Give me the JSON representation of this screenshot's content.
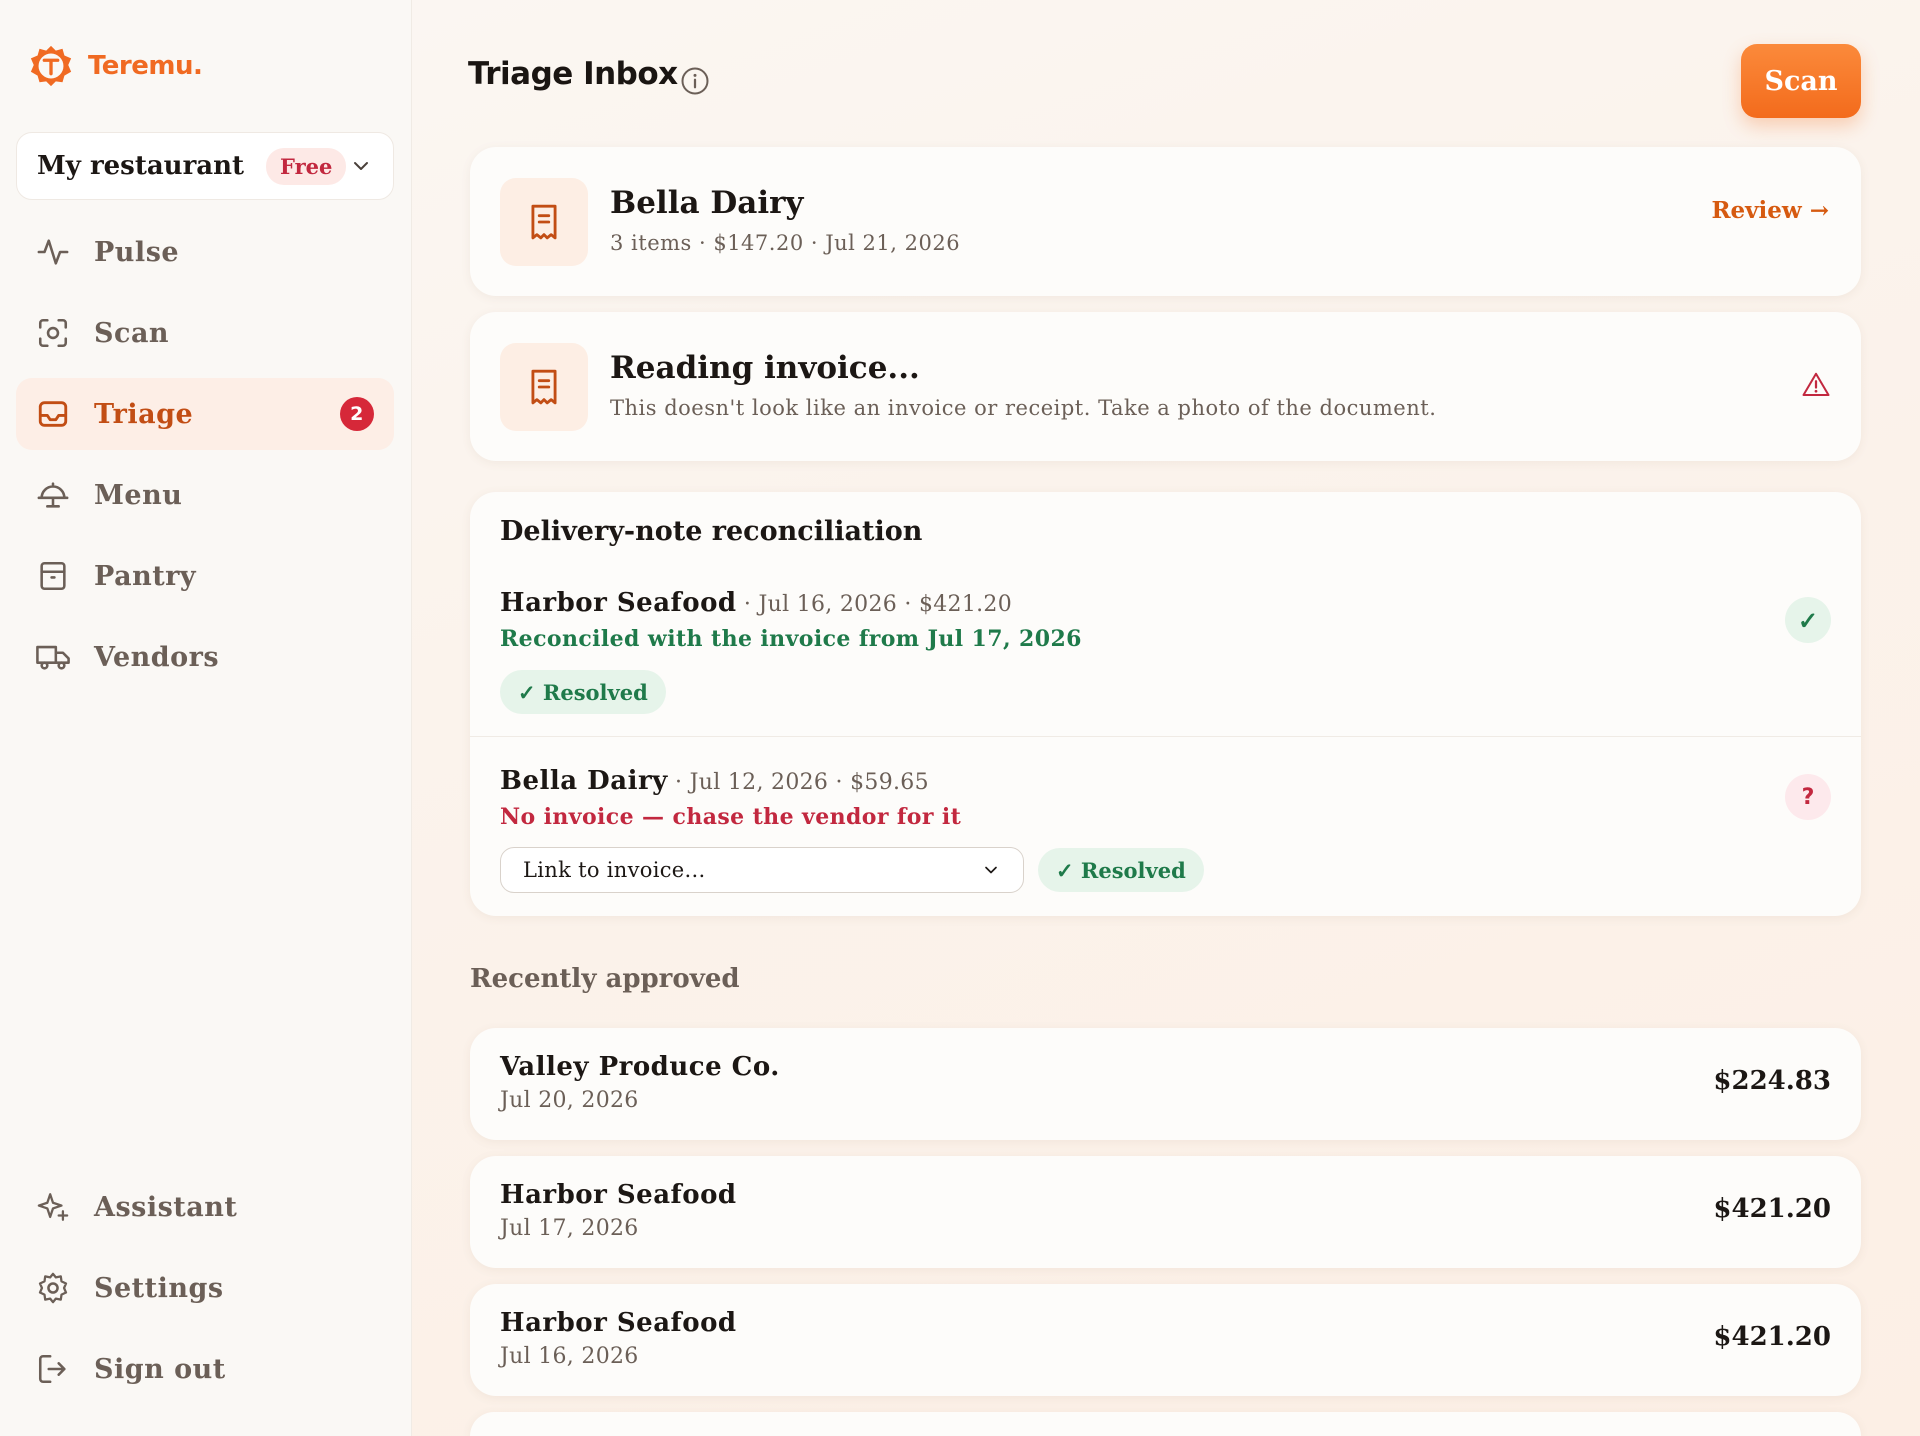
{
  "brand": {
    "name": "Teremu.",
    "accent": "#f06a22"
  },
  "workspace": {
    "name": "My restaurant",
    "plan": "Free"
  },
  "nav": {
    "main": [
      {
        "label": "Pulse",
        "icon": "activity-icon"
      },
      {
        "label": "Scan",
        "icon": "scan-icon"
      },
      {
        "label": "Triage",
        "icon": "inbox-icon",
        "badge": "2",
        "active": true
      },
      {
        "label": "Menu",
        "icon": "cloche-icon"
      },
      {
        "label": "Pantry",
        "icon": "pantry-icon"
      },
      {
        "label": "Vendors",
        "icon": "truck-icon"
      }
    ],
    "bottom": [
      {
        "label": "Assistant",
        "icon": "sparkle-icon"
      },
      {
        "label": "Settings",
        "icon": "gear-icon"
      },
      {
        "label": "Sign out",
        "icon": "sign-out-icon"
      }
    ]
  },
  "header": {
    "title": "Triage Inbox",
    "scan_label": "Scan"
  },
  "inbox": [
    {
      "title": "Bella Dairy",
      "subtitle": "3 items · $147.20 · Jul 21, 2026",
      "action": "Review →"
    },
    {
      "title": "Reading invoice...",
      "subtitle": "This doesn't look like an invoice or receipt. Take a photo of the document."
    }
  ],
  "reconciliation": {
    "title": "Delivery-note reconciliation",
    "rows": [
      {
        "vendor": "Harbor Seafood",
        "meta": " · Jul 16, 2026 · $421.20",
        "message": "Reconciled with the invoice from Jul 17, 2026",
        "resolved_label": "✓ Resolved",
        "status": "✓"
      },
      {
        "vendor": "Bella Dairy",
        "meta": " · Jul 12, 2026 · $59.65",
        "message": "No invoice — chase the vendor for it",
        "select_value": "Link to invoice...",
        "resolved_label": "✓ Resolved",
        "status": "?"
      }
    ]
  },
  "recent": {
    "title": "Recently approved",
    "items": [
      {
        "vendor": "Valley Produce Co.",
        "date": "Jul 20, 2026",
        "amount": "$224.83"
      },
      {
        "vendor": "Harbor Seafood",
        "date": "Jul 17, 2026",
        "amount": "$421.20"
      },
      {
        "vendor": "Harbor Seafood",
        "date": "Jul 16, 2026",
        "amount": "$421.20"
      }
    ]
  }
}
